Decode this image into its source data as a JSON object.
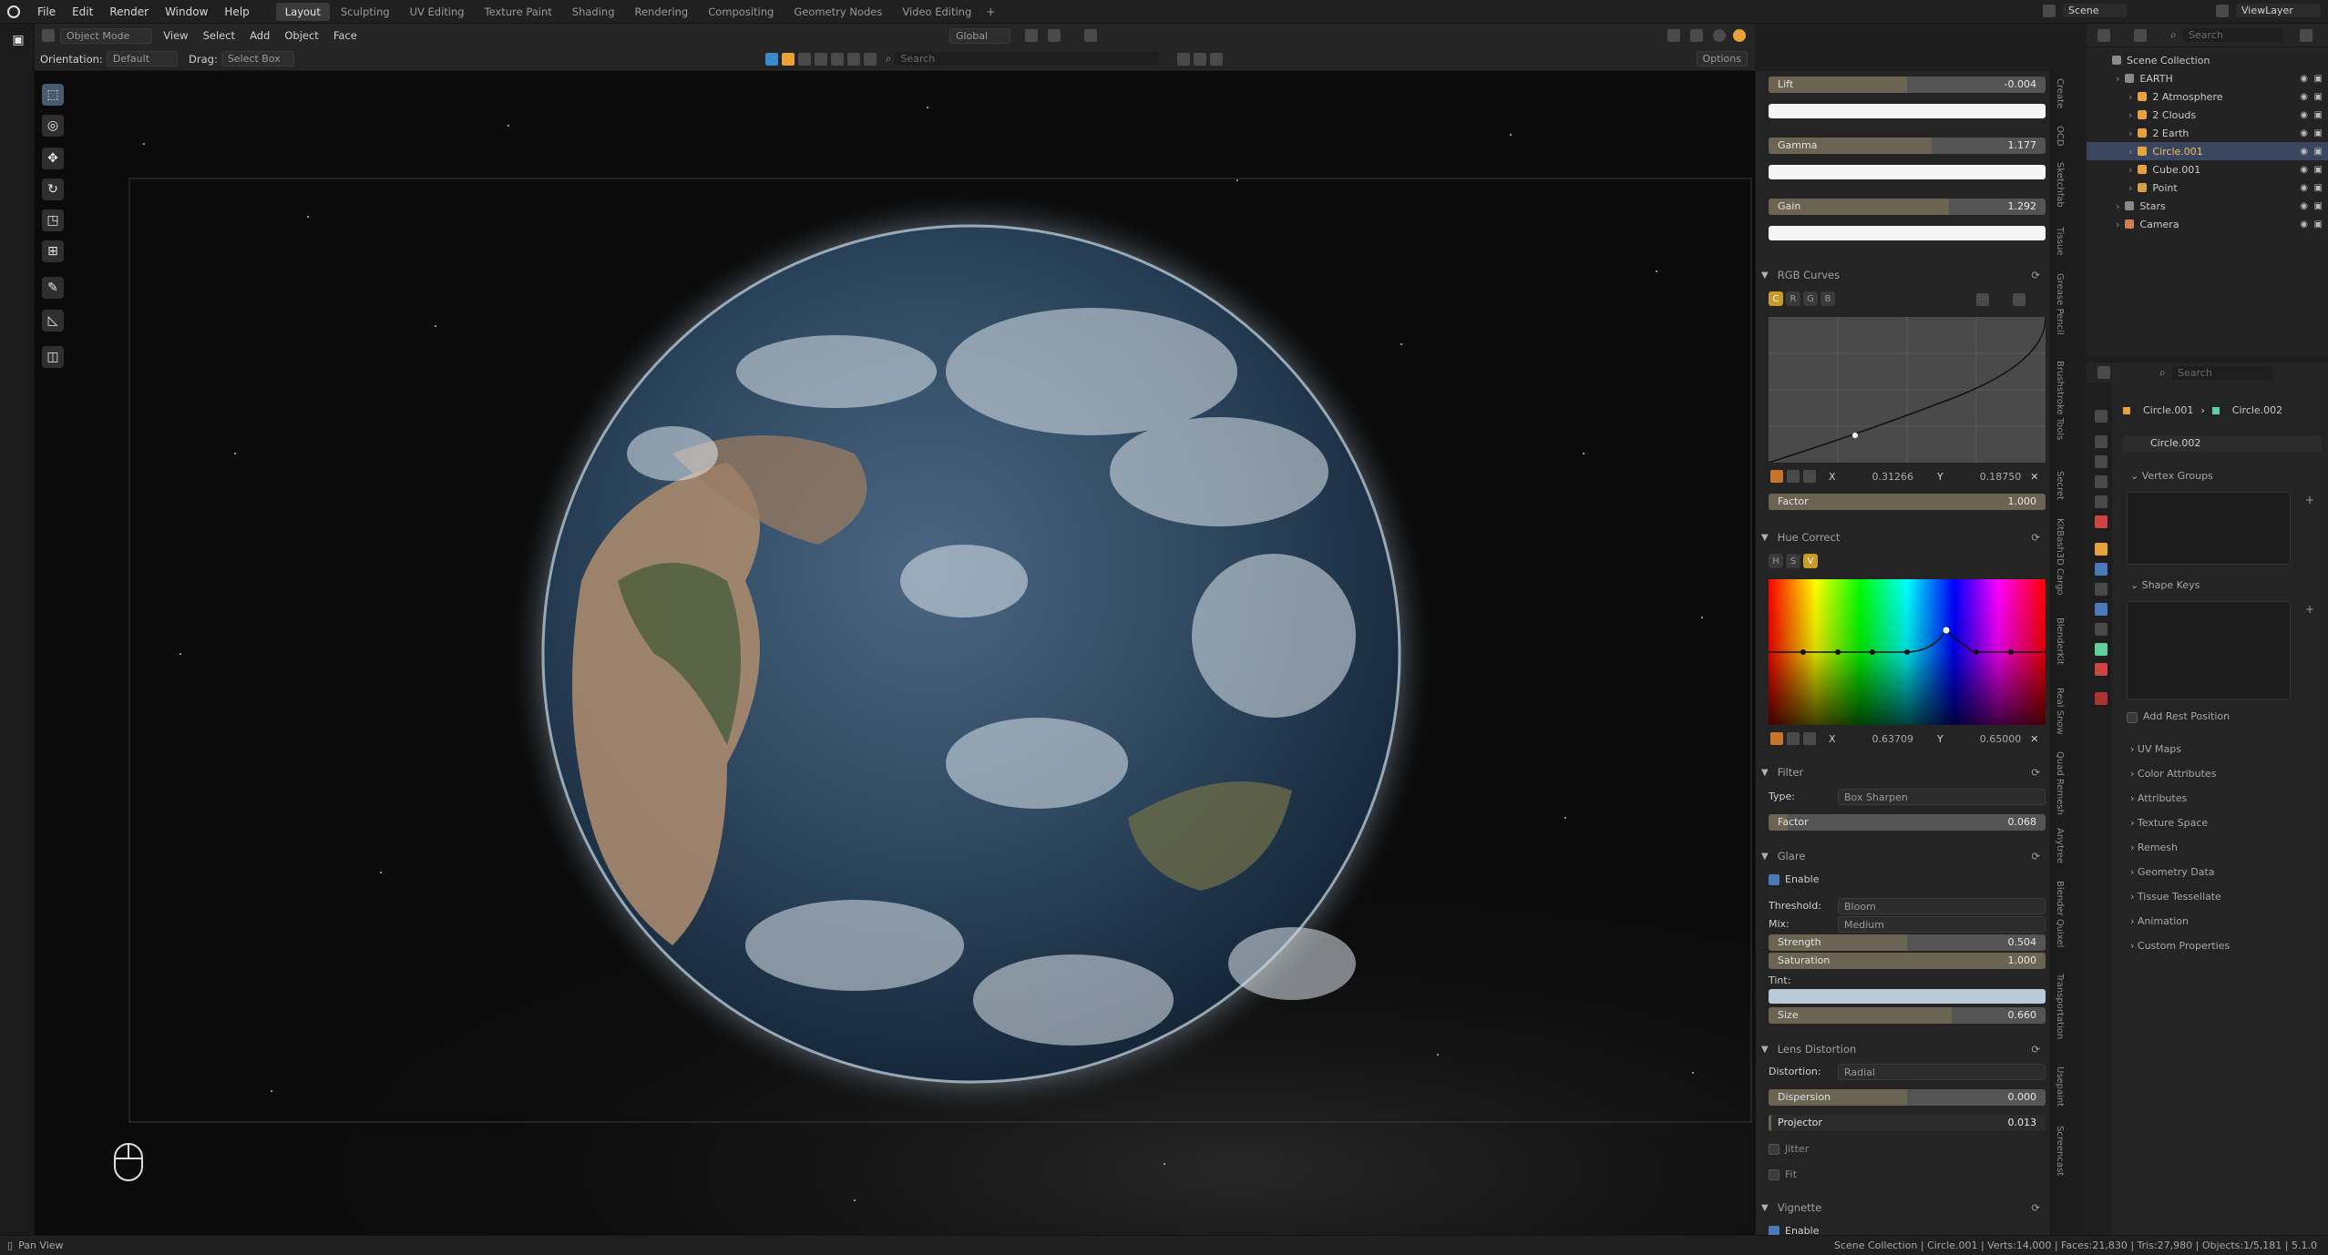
{
  "menu": {
    "items": [
      "File",
      "Edit",
      "Render",
      "Window",
      "Help"
    ],
    "workspaces": [
      "Layout",
      "Sculpting",
      "UV Editing",
      "Texture Paint",
      "Shading",
      "Rendering",
      "Compositing",
      "Geometry Nodes",
      "Video Editing"
    ],
    "active_workspace": "Layout",
    "scene": "Scene",
    "view_layer": "ViewLayer"
  },
  "viewport_header": {
    "mode": "Object Mode",
    "menus": [
      "View",
      "Select",
      "Add",
      "Object",
      "Face"
    ],
    "orientation_label": "Orientation:",
    "orientation_value": "Default",
    "drag_label": "Drag:",
    "drag_value": "Select Box",
    "transform": "Global",
    "search_placeholder": "Search",
    "options": "Options"
  },
  "compositor": {
    "lift": {
      "label": "Lift",
      "value": "-0.004",
      "fill": 0.5
    },
    "gamma": {
      "label": "Gamma",
      "value": "1.177",
      "fill": 0.59
    },
    "gain": {
      "label": "Gain",
      "value": "1.292",
      "fill": 0.65
    },
    "rgb_curves": {
      "title": "RGB Curves",
      "channels": [
        "C",
        "R",
        "G",
        "B"
      ],
      "x_label": "X",
      "x_value": "0.31266",
      "y_label": "Y",
      "y_value": "0.18750",
      "factor_label": "Factor",
      "factor_value": "1.000"
    },
    "hue_correct": {
      "title": "Hue Correct",
      "channels": [
        "H",
        "S",
        "V"
      ],
      "x_label": "X",
      "x_value": "0.63709",
      "y_label": "Y",
      "y_value": "0.65000"
    },
    "filter": {
      "title": "Filter",
      "type_label": "Type:",
      "type_value": "Box Sharpen",
      "factor_label": "Factor",
      "factor_value": "0.068"
    },
    "glare": {
      "title": "Glare",
      "enable_label": "Enable",
      "threshold_label": "Threshold:",
      "threshold_value": "Bloom",
      "mix_label": "Mix:",
      "mix_value": "Medium",
      "strength_label": "Strength",
      "strength_value": "0.504",
      "saturation_label": "Saturation",
      "saturation_value": "1.000",
      "tint_label": "Tint:",
      "size_label": "Size",
      "size_value": "0.660"
    },
    "lens": {
      "title": "Lens Distortion",
      "distortion_label": "Distortion:",
      "distortion_value": "Radial",
      "dispersion_label": "Dispersion",
      "dispersion_value": "0.000",
      "projector_label": "Projector",
      "projector_value": "0.013",
      "jitter_label": "Jitter",
      "fit_label": "Fit"
    },
    "vignette": {
      "title": "Vignette",
      "enable_label": "Enable"
    }
  },
  "side_tabs": [
    "Create",
    "OCD",
    "Sketchfab",
    "Tissue",
    "Grease Pencil",
    "Brushstroke Tools",
    "Secret",
    "KitBash3D Cargo",
    "BlenderKit",
    "Real Snow",
    "Quad Remesh",
    "Anytree",
    "Blender Quixel",
    "Transportation",
    "Usepaint",
    "Screencast"
  ],
  "outliner": {
    "search_placeholder": "Search",
    "root": "Scene Collection",
    "rows": [
      {
        "label": "EARTH",
        "indent": 1,
        "selected": false
      },
      {
        "label": "2 Atmosphere",
        "indent": 2,
        "selected": false
      },
      {
        "label": "2 Clouds",
        "indent": 2,
        "selected": false
      },
      {
        "label": "2 Earth",
        "indent": 2,
        "selected": false
      },
      {
        "label": "Circle.001",
        "indent": 2,
        "selected": true
      },
      {
        "label": "Cube.001",
        "indent": 2,
        "selected": false
      },
      {
        "label": "Point",
        "indent": 2,
        "selected": false
      },
      {
        "label": "Stars",
        "indent": 1,
        "selected": false
      },
      {
        "label": "Camera",
        "indent": 1,
        "selected": false
      }
    ]
  },
  "properties": {
    "search_placeholder": "Search",
    "breadcrumb_object": "Circle.001",
    "breadcrumb_data": "Circle.002",
    "mesh_name": "Circle.002",
    "vertex_groups": "Vertex Groups",
    "shape_keys": "Shape Keys",
    "add_rest_position": "Add Rest Position",
    "sections": [
      "UV Maps",
      "Color Attributes",
      "Attributes",
      "Texture Space",
      "Remesh",
      "Geometry Data",
      "Tissue Tessellate",
      "Animation",
      "Custom Properties"
    ]
  },
  "status": {
    "left": "Pan View",
    "right": "Scene Collection | Circle.001 | Verts:14,000 | Faces:21,830 | Tris:27,980 | Objects:1/5,181 | 5.1.0"
  },
  "colors": {
    "accent": "#e8a23a",
    "selection": "#3a4660",
    "slider_fill": "#6b6452"
  }
}
